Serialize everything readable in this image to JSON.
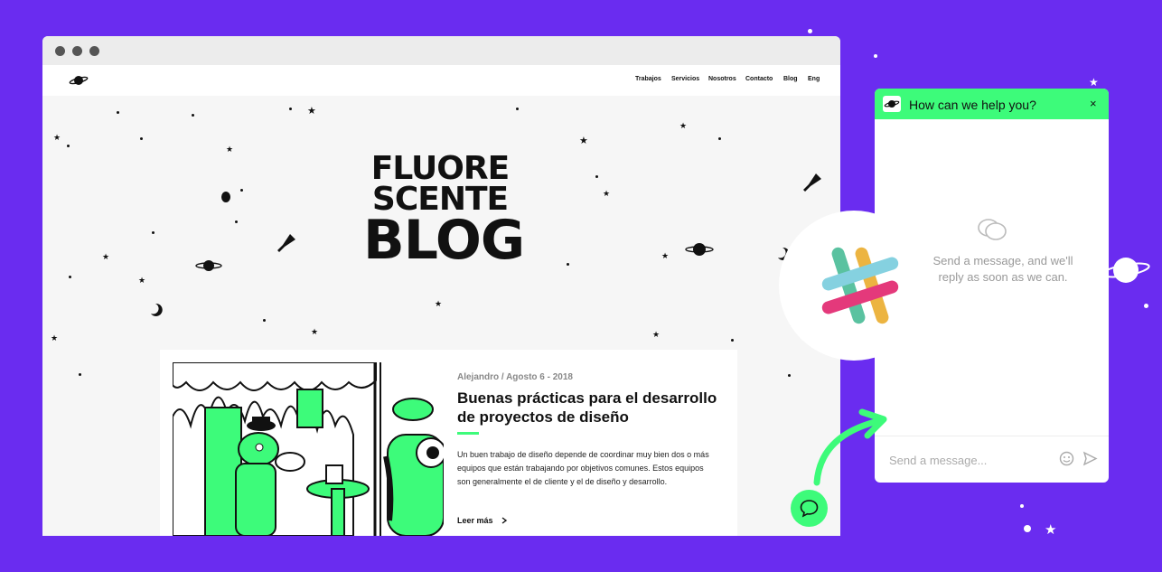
{
  "browser": {
    "nav_items": [
      "Trabajos",
      "Servicios",
      "Nosotros",
      "Contacto",
      "Blog",
      "Eng"
    ]
  },
  "hero": {
    "logo_lines": [
      "FLUORE",
      "SCENTE",
      "BLOG"
    ]
  },
  "post": {
    "meta": "Alejandro / Agosto 6 - 2018",
    "title": "Buenas prácticas para el desarrollo de proyectos de diseño",
    "excerpt": "Un buen trabajo de diseño depende de coordinar muy bien dos o más equipos que están trabajando por objetivos comunes. Estos equipos son generalmente el de cliente y el de diseño y desarrollo.",
    "read_more": "Leer más"
  },
  "chat": {
    "title": "How can we help you?",
    "close": "×",
    "empty_message": "Send a message, and we'll reply as soon as we can.",
    "input_placeholder": "Send a message..."
  },
  "colors": {
    "background": "#6a2cf0",
    "accent": "#3dfb7a"
  },
  "icons": [
    "planet-logo-icon",
    "chat-bubbles-icon",
    "emoji-icon",
    "send-icon",
    "slack-icon",
    "chat-launcher-icon",
    "close-icon",
    "chevron-right-icon"
  ]
}
